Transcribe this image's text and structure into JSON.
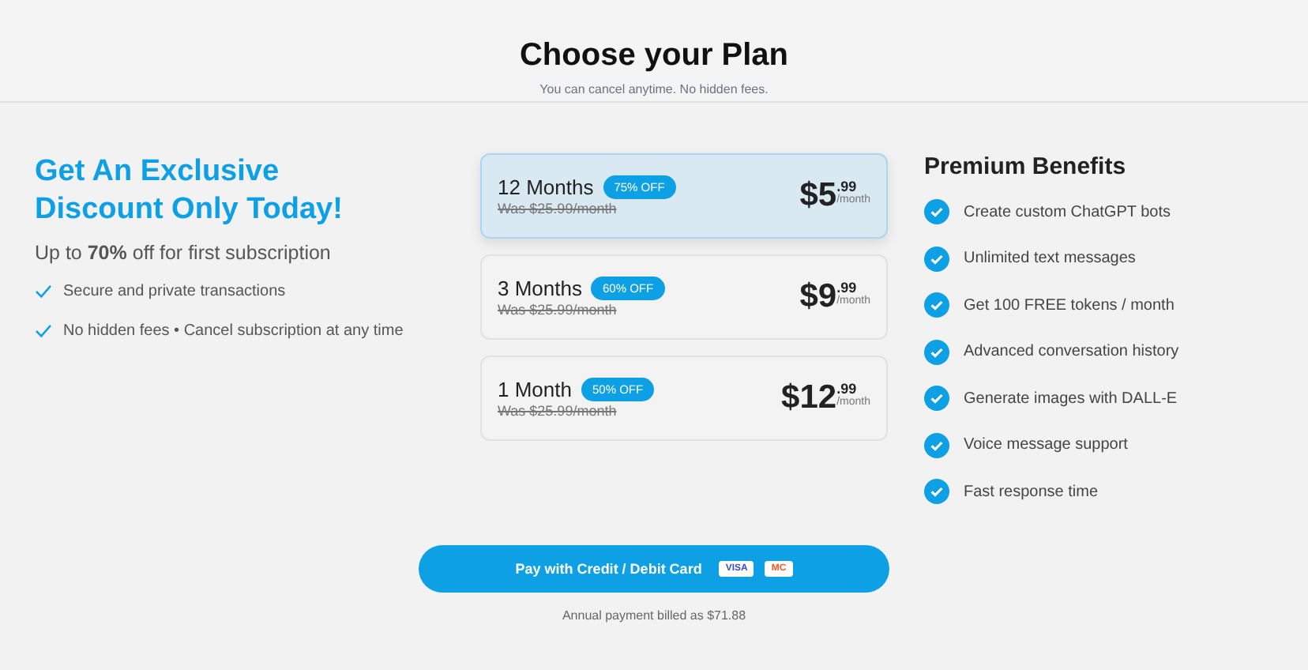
{
  "header": {
    "title": "Choose your Plan",
    "subtitle": "You can cancel anytime. No hidden fees."
  },
  "promo": {
    "heading": "Get An Exclusive Discount Only Today!",
    "subtitle": "Up to **70%** off for first subscription",
    "points": [
      "Secure and private transactions",
      "No hidden fees • Cancel subscription at any time"
    ]
  },
  "plans": [
    {
      "name": "12 Months",
      "badge": "75% OFF",
      "was": "Was $25.99/month",
      "price": "$5",
      "cents": ".99",
      "per": "/month",
      "selected": true
    },
    {
      "name": "3 Months",
      "badge": "60% OFF",
      "was": "Was $25.99/month",
      "price": "$9",
      "cents": ".99",
      "per": "/month",
      "selected": false
    },
    {
      "name": "1 Month",
      "badge": "50% OFF",
      "was": "Was $25.99/month",
      "price": "$12",
      "cents": ".99",
      "per": "/month",
      "selected": false
    }
  ],
  "benefits": {
    "title": "Premium Benefits",
    "items": [
      "Create custom ChatGPT bots",
      "Unlimited text messages",
      "Get 100 FREE tokens / month",
      "Advanced conversation history",
      "Generate images with DALL-E",
      "Voice message support",
      "Fast response time"
    ]
  },
  "payment": {
    "button": "Pay with Credit / Debit Card",
    "cards": [
      "VISA",
      "MC"
    ],
    "note": "Annual payment billed as $71.88"
  }
}
